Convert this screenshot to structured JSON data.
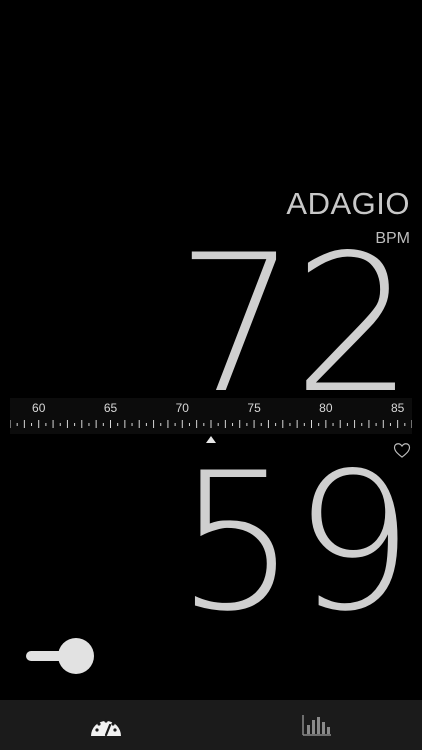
{
  "tempo": {
    "name": "ADAGIO",
    "unit": "BPM",
    "target_bpm": "72"
  },
  "ruler": {
    "labels": [
      "60",
      "65",
      "70",
      "75",
      "80",
      "85"
    ],
    "min": 58,
    "max": 86,
    "pointer_value": 72
  },
  "measured": {
    "value": "59"
  },
  "icons": {
    "favorite": "heart-outline-icon",
    "tab1": "speedometer-icon",
    "tab2": "bar-chart-icon"
  },
  "toggle": {
    "state": "on"
  },
  "colors": {
    "background": "#000000",
    "text": "#cfcfcf",
    "tabbar": "#1b1b1b"
  }
}
